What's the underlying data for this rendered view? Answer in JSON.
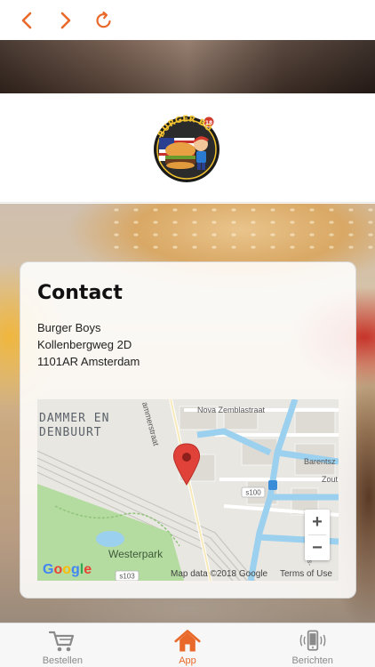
{
  "colors": {
    "accent": "#e8692a",
    "tab_inactive": "#8a8a8a",
    "map_water": "#9bd0ef",
    "map_park": "#b4dba0",
    "pin": "#e0423a"
  },
  "topbar": {
    "icons": [
      "back-arrow-icon",
      "forward-arrow-icon",
      "reload-icon"
    ]
  },
  "logo": {
    "text": "BURGER BOYS",
    "badge": "18"
  },
  "contact": {
    "title": "Contact",
    "name": "Burger Boys",
    "street": "Kollenbergweg 2D",
    "city": "1101AR Amsterdam"
  },
  "map": {
    "district_line1": "DAMMER EN",
    "district_line2": "DENBUURT",
    "street_nova": "Nova Zemblastraat",
    "street_diagonal": "ammerstraat",
    "street_barents": "Barentsz",
    "street_zout": "Zout",
    "road_s100": "s100",
    "road_s103": "s103",
    "park": "Westerpark",
    "side_street": "ns-",
    "zoom_in": "+",
    "zoom_out": "−",
    "brand": "Google",
    "attribution": "Map data ©2018 Google",
    "terms": "Terms of Use"
  },
  "tabs": [
    {
      "label": "Bestellen",
      "icon": "cart-icon",
      "active": false
    },
    {
      "label": "App",
      "icon": "home-icon",
      "active": true
    },
    {
      "label": "Berichten",
      "icon": "phone-vibrate-icon",
      "active": false
    }
  ]
}
